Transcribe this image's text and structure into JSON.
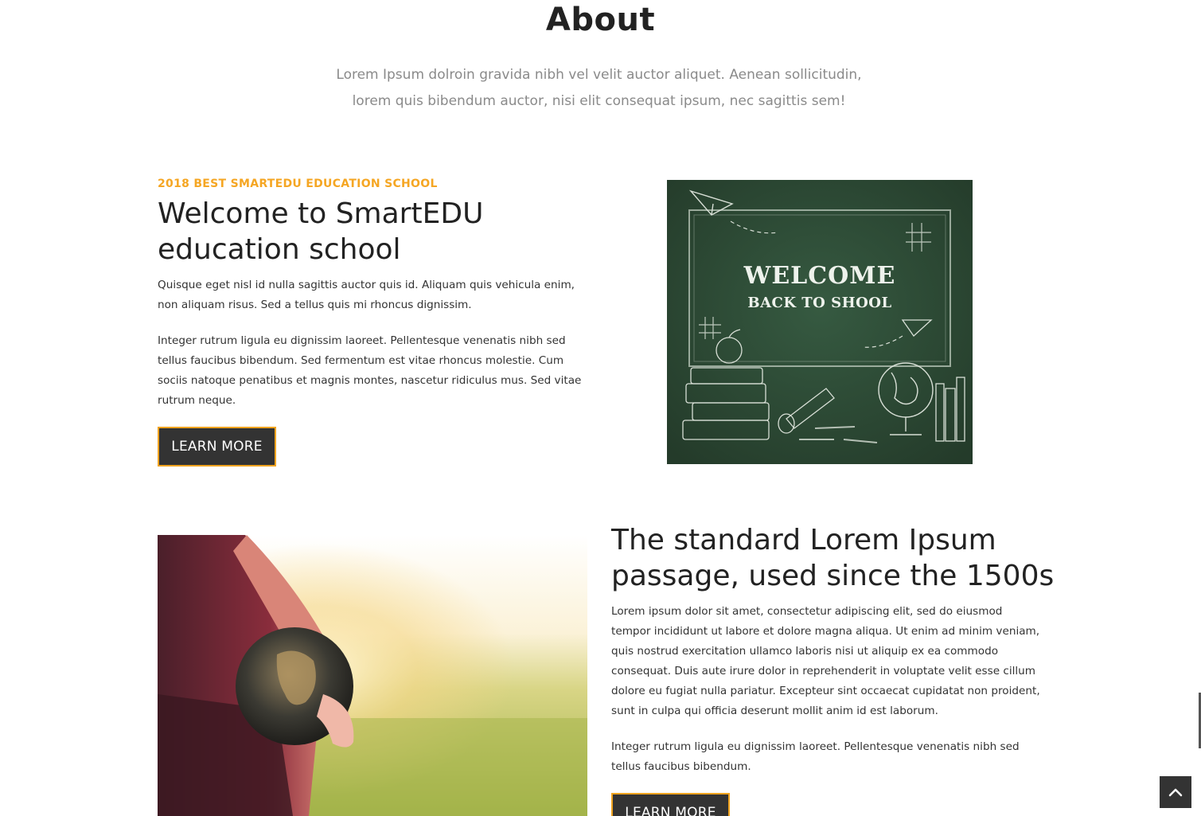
{
  "about": {
    "title": "About",
    "lead": "Lorem Ipsum dolroin gravida nibh vel velit auctor aliquet. Aenean sollicitudin, lorem quis bibendum auctor, nisi elit consequat ipsum, nec sagittis sem!"
  },
  "section1": {
    "eyebrow": "2018 BEST SMARTEDU EDUCATION SCHOOL",
    "heading": "Welcome to SmartEDU education school",
    "para1": "Quisque eget nisl id nulla sagittis auctor quis id. Aliquam quis vehicula enim, non aliquam risus. Sed a tellus quis mi rhoncus dignissim.",
    "para2": "Integer rutrum ligula eu dignissim laoreet. Pellentesque venenatis nibh sed tellus faucibus bibendum. Sed fermentum est vitae rhoncus molestie. Cum sociis natoque penatibus et magnis montes, nascetur ridiculus mus. Sed vitae rutrum neque.",
    "button": "LEARN MORE",
    "image": {
      "line1": "WELCOME",
      "line2": "BACK TO SHOOL"
    }
  },
  "section2": {
    "heading": "The standard Lorem Ipsum passage, used since the 1500s",
    "para1": "Lorem ipsum dolor sit amet, consectetur adipiscing elit, sed do eiusmod tempor incididunt ut labore et dolore magna aliqua. Ut enim ad minim veniam, quis nostrud exercitation ullamco laboris nisi ut aliquip ex ea commodo consequat. Duis aute irure dolor in reprehenderit in voluptate velit esse cillum dolore eu fugiat nulla pariatur. Excepteur sint occaecat cupidatat non proident, sunt in culpa qui officia deserunt mollit anim id est laborum.",
    "para2": "Integer rutrum ligula eu dignissim laoreet. Pellentesque venenatis nibh sed tellus faucibus bibendum.",
    "button": "LEARN MORE"
  },
  "colors": {
    "accent": "#f5a623",
    "button_bg": "#333333",
    "board": "#2f4a36",
    "text_muted": "#8a8a8a"
  },
  "icons": {
    "scroll_top": "chevron-up-icon"
  }
}
